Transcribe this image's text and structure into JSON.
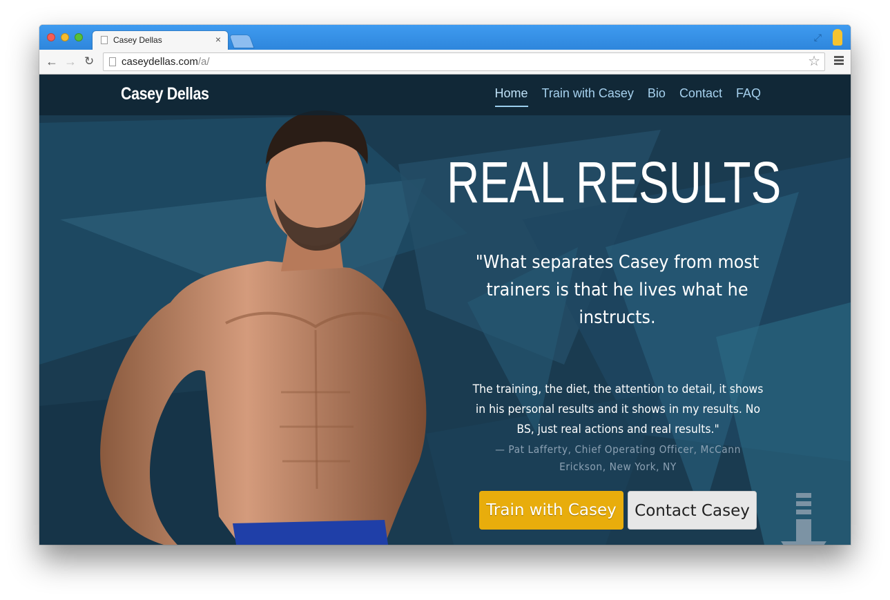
{
  "browser": {
    "tab_title": "Casey Dellas",
    "tab_close": "×",
    "url_domain": "caseydellas.com",
    "url_path": "/a/"
  },
  "site": {
    "brand": "Casey Dellas",
    "nav": [
      {
        "label": "Home",
        "active": true
      },
      {
        "label": "Train with Casey",
        "active": false
      },
      {
        "label": "Bio",
        "active": false
      },
      {
        "label": "Contact",
        "active": false
      },
      {
        "label": "FAQ",
        "active": false
      }
    ]
  },
  "hero": {
    "title": "REAL RESULTS",
    "quote_lead": "\"What separates Casey from most trainers is that he lives what he instructs.",
    "quote_body": "The training, the diet, the attention to detail, it shows in his personal results and it shows in my results. No BS, just real actions and real results.\"",
    "cite": "— Pat Lafferty, Chief Operating Officer, McCann Erickson, New York, NY",
    "primary_button": "Train with Casey",
    "secondary_button": "Contact Casey"
  },
  "icons": {
    "back": "back-arrow-icon",
    "forward": "forward-arrow-icon",
    "reload": "reload-icon",
    "bookmark": "star-icon",
    "menu": "hamburger-menu-icon",
    "scroll": "scroll-down-arrow-icon"
  },
  "colors": {
    "page_bg": "#1a3b50",
    "nav_link": "#a6d1ee",
    "primary_button": "#e8ad0c",
    "secondary_button": "#e7e7e7",
    "titlebar": "#3f9bf0"
  }
}
